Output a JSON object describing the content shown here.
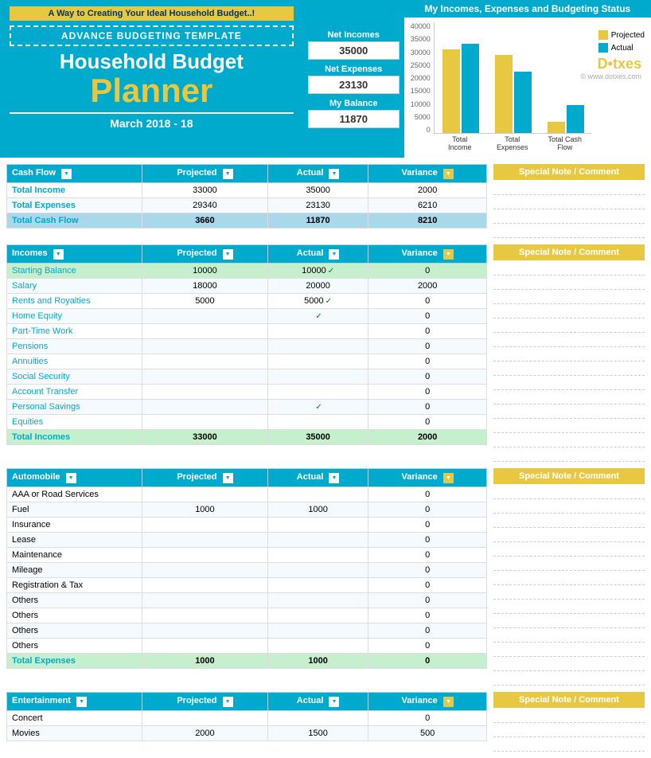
{
  "header": {
    "banner": "A Way to Creating Your Ideal Household Budget..!",
    "template_label": "ADVANCE BUDGETING TEMPLATE",
    "title": "Household Budget",
    "subtitle": "Planner",
    "date": "March 2018 - 18",
    "net_incomes_label": "Net Incomes",
    "net_incomes_value": "35000",
    "net_expenses_label": "Net Expenses",
    "net_expenses_value": "23130",
    "my_balance_label": "My Balance",
    "my_balance_value": "11870",
    "chart_title": "My Incomes, Expenses and Budgeting Status",
    "logo": "D•txes",
    "logo_sub": "© www.dotxes.com"
  },
  "chart": {
    "y_labels": [
      "40000",
      "35000",
      "30000",
      "25000",
      "20000",
      "15000",
      "10000",
      "5000",
      "0"
    ],
    "groups": [
      {
        "label": "Total Income",
        "projected": 30000,
        "actual": 32000
      },
      {
        "label": "Total Expenses",
        "projected": 28000,
        "actual": 22000
      },
      {
        "label": "Total Cash Flow",
        "projected": 4000,
        "actual": 10000
      }
    ],
    "max": 40000,
    "legend": [
      {
        "color": "#e8c840",
        "label": "Projected"
      },
      {
        "color": "#00aacc",
        "label": "Actual"
      }
    ]
  },
  "cashflow": {
    "header": "Cash Flow",
    "cols": [
      "Projected",
      "Actual",
      "Variance"
    ],
    "rows": [
      {
        "label": "Total Income",
        "projected": "33000",
        "actual": "35000",
        "variance": "2000",
        "highlight": false
      },
      {
        "label": "Total Expenses",
        "projected": "29340",
        "actual": "23130",
        "variance": "6210",
        "highlight": false
      },
      {
        "label": "Total Cash Flow",
        "projected": "3660",
        "actual": "11870",
        "variance": "8210",
        "highlight": true
      }
    ],
    "note_header": "Special Note / Comment"
  },
  "incomes": {
    "header": "Incomes",
    "cols": [
      "Projected",
      "Actual",
      "Variance"
    ],
    "rows": [
      {
        "label": "Starting Balance",
        "projected": "10000",
        "actual": "10000",
        "variance": "0",
        "green": true
      },
      {
        "label": "Salary",
        "projected": "18000",
        "actual": "20000",
        "variance": "2000",
        "green": false
      },
      {
        "label": "Rents and Royalties",
        "projected": "5000",
        "actual": "5000",
        "variance": "0",
        "green": true
      },
      {
        "label": "Home Equity",
        "projected": "",
        "actual": "",
        "variance": "0",
        "green": true
      },
      {
        "label": "Part-Time Work",
        "projected": "",
        "actual": "",
        "variance": "0",
        "green": false
      },
      {
        "label": "Pensions",
        "projected": "",
        "actual": "",
        "variance": "0",
        "green": false
      },
      {
        "label": "Annuities",
        "projected": "",
        "actual": "",
        "variance": "0",
        "green": false
      },
      {
        "label": "Social Security",
        "projected": "",
        "actual": "",
        "variance": "0",
        "green": false
      },
      {
        "label": "Account Transfer",
        "projected": "",
        "actual": "",
        "variance": "0",
        "green": false
      },
      {
        "label": "Personal Savings",
        "projected": "",
        "actual": "",
        "variance": "0",
        "green": true
      },
      {
        "label": "Equities",
        "projected": "",
        "actual": "",
        "variance": "0",
        "green": false
      }
    ],
    "total_row": {
      "label": "Total Incomes",
      "projected": "33000",
      "actual": "35000",
      "variance": "2000"
    },
    "note_header": "Special Note / Comment"
  },
  "automobile": {
    "header": "Automobile",
    "cols": [
      "Projected",
      "Actual",
      "Variance"
    ],
    "rows": [
      {
        "label": "AAA or Road Services",
        "projected": "",
        "actual": "",
        "variance": "0"
      },
      {
        "label": "Fuel",
        "projected": "1000",
        "actual": "1000",
        "variance": "0"
      },
      {
        "label": "Insurance",
        "projected": "",
        "actual": "",
        "variance": "0"
      },
      {
        "label": "Lease",
        "projected": "",
        "actual": "",
        "variance": "0"
      },
      {
        "label": "Maintenance",
        "projected": "",
        "actual": "",
        "variance": "0"
      },
      {
        "label": "Mileage",
        "projected": "",
        "actual": "",
        "variance": "0"
      },
      {
        "label": "Registration & Tax",
        "projected": "",
        "actual": "",
        "variance": "0"
      },
      {
        "label": "Others",
        "projected": "",
        "actual": "",
        "variance": "0"
      },
      {
        "label": "Others",
        "projected": "",
        "actual": "",
        "variance": "0"
      },
      {
        "label": "Others",
        "projected": "",
        "actual": "",
        "variance": "0"
      },
      {
        "label": "Others",
        "projected": "",
        "actual": "",
        "variance": "0"
      }
    ],
    "total_row": {
      "label": "Total  Expenses",
      "projected": "1000",
      "actual": "1000",
      "variance": "0"
    },
    "note_header": "Special Note / Comment"
  },
  "entertainment": {
    "header": "Entertainment",
    "cols": [
      "Projected",
      "Actual",
      "Variance"
    ],
    "rows": [
      {
        "label": "Concert",
        "projected": "",
        "actual": "",
        "variance": "0"
      },
      {
        "label": "Movies",
        "projected": "2000",
        "actual": "1500",
        "variance": "500"
      }
    ],
    "note_header": "Special Note / Comment"
  }
}
